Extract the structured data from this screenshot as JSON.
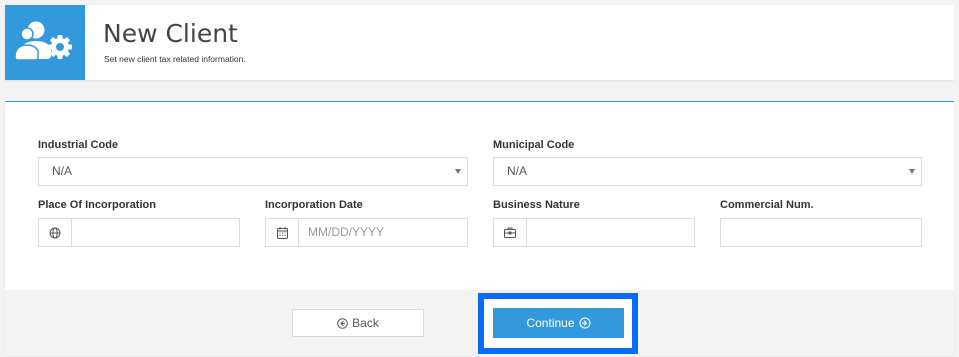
{
  "header": {
    "icon": "users-gear-icon",
    "title": "New Client",
    "subtitle": "Set new client tax related information."
  },
  "form": {
    "industrial_code": {
      "label": "Industrial Code",
      "value": "N/A"
    },
    "municipal_code": {
      "label": "Municipal Code",
      "value": "N/A"
    },
    "place_of_incorporation": {
      "label": "Place Of Incorporation",
      "icon": "globe-icon",
      "value": ""
    },
    "incorporation_date": {
      "label": "Incorporation Date",
      "icon": "calendar-icon",
      "placeholder": "MM/DD/YYYY"
    },
    "business_nature": {
      "label": "Business Nature",
      "icon": "briefcase-icon",
      "value": ""
    },
    "commercial_num": {
      "label": "Commercial Num.",
      "value": ""
    }
  },
  "footer": {
    "back_label": "Back",
    "continue_label": "Continue"
  },
  "colors": {
    "accent": "#3399dd",
    "highlight": "#0a6cf5",
    "background": "#f3f3f3"
  }
}
